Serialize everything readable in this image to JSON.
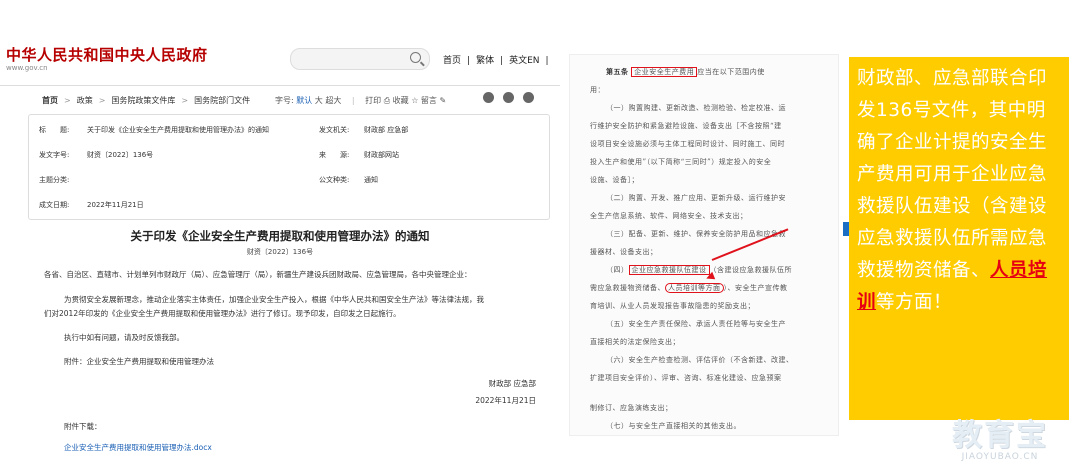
{
  "gov": {
    "site_title": "中华人民共和国中央人民政府",
    "site_url": "www.gov.cn",
    "nav": [
      "首页",
      "|",
      "繁体",
      "|",
      "英文EN",
      "|"
    ],
    "breadcrumb": [
      "首页",
      "政策",
      "国务院政策文件库",
      "国务院部门文件"
    ],
    "tools": {
      "font_label": "字号:",
      "font_default": "默认",
      "font_large": "大",
      "font_xlarge": "超大",
      "print": "打印",
      "favorite": "收藏",
      "comment": "留言"
    },
    "meta": {
      "title_label": "标　　题:",
      "title_value": "关于印发《企业安全生产费用提取和使用管理办法》的通知",
      "issuer_label": "发文机关:",
      "issuer_value": "财政部 应急部",
      "docno_label": "发文字号:",
      "docno_value": "财资〔2022〕136号",
      "source_label": "来　　源:",
      "source_value": "财政部网站",
      "topic_label": "主题分类:",
      "topic_value": "",
      "type_label": "公文种类:",
      "type_value": "通知",
      "date_label": "成文日期:",
      "date_value": "2022年11月21日"
    },
    "doc_title": "关于印发《企业安全生产费用提取和使用管理办法》的通知",
    "doc_no": "财资〔2022〕136号",
    "para1": "各省、自治区、直辖市、计划单列市财政厅（局）、应急管理厅（局），新疆生产建设兵团财政局、应急管理局，各中央管理企业：",
    "para2a": "为贯彻安全发展新理念，推动企业落实主体责任，加强企业安全生产投入，根据《中华人民共和国安全生产法》等法律法规，我",
    "para2b": "们对2012年印发的《企业安全生产费用提取和使用管理办法》进行了修订。现予印发，自印发之日起施行。",
    "para3": "执行中如有问题，请及时反馈我部。",
    "para4": "附件：企业安全生产费用提取和使用管理办法",
    "sign_org": "财政部 应急部",
    "sign_date": "2022年11月21日",
    "download_label": "附件下载：",
    "download_link": "企业安全生产费用提取和使用管理办法.docx"
  },
  "scan": {
    "l1_pre": "第五条",
    "l1_box": "企业安全生产费用",
    "l1_post": "应当在以下范围内使",
    "l2": "用：",
    "l3": "（一）购置购建、更新改造、检测检验、检定校准、运",
    "l4": "行维护安全防护和紧急避险设施、设备支出［不含按照“建",
    "l5": "设项目安全设施必须与主体工程同时设计、同时施工、同时",
    "l6": "投入生产和使用”（以下简称“三同时”）规定投入的安全",
    "l7": "设施、设备］；",
    "l8": "（二）购置、开发、推广应用、更新升级、运行维护安",
    "l9": "全生产信息系统、软件、网络安全、技术支出；",
    "l10": "（三）配备、更新、维护、保养安全防护用品和应急救",
    "l11": "援器材、设备支出；",
    "l12_pre": "（四）",
    "l12_box": "企业应急救援队伍建设",
    "l12_post": "（含建设应急救援队伍所",
    "l13_pre": "需应急救援物资储备、",
    "l13_oval": "人员培训等方面",
    "l13_post": "）、安全生产宣传教",
    "l14": "育培训、从业人员发现报告事故隐患的奖励支出；",
    "l15": "（五）安全生产责任保险、承运人责任险等与安全生产",
    "l16": "直接相关的法定保险支出；",
    "l17": "（六）安全生产检查检测、评估评价（不含新建、改建、",
    "l18": "扩建项目安全评价）、评审、咨询、标准化建设、应急预案",
    "l19": "制修订、应急演练支出；",
    "l20": "（七）与安全生产直接相关的其他支出。"
  },
  "panel": {
    "text_main": "财政部、应急部联合印发136号文件，其中明确了企业计提的安全生产费用可用于企业应急救援队伍建设（含建设应急救援队伍所需应急救援物资储备、",
    "text_highlight": "人员培训",
    "text_tail": "等方面！",
    "bg_color": "#ffcc00",
    "highlight_color": "#e60012"
  },
  "watermark": {
    "cn": "教育宝",
    "en": "JIAOYUBAO.CN"
  }
}
